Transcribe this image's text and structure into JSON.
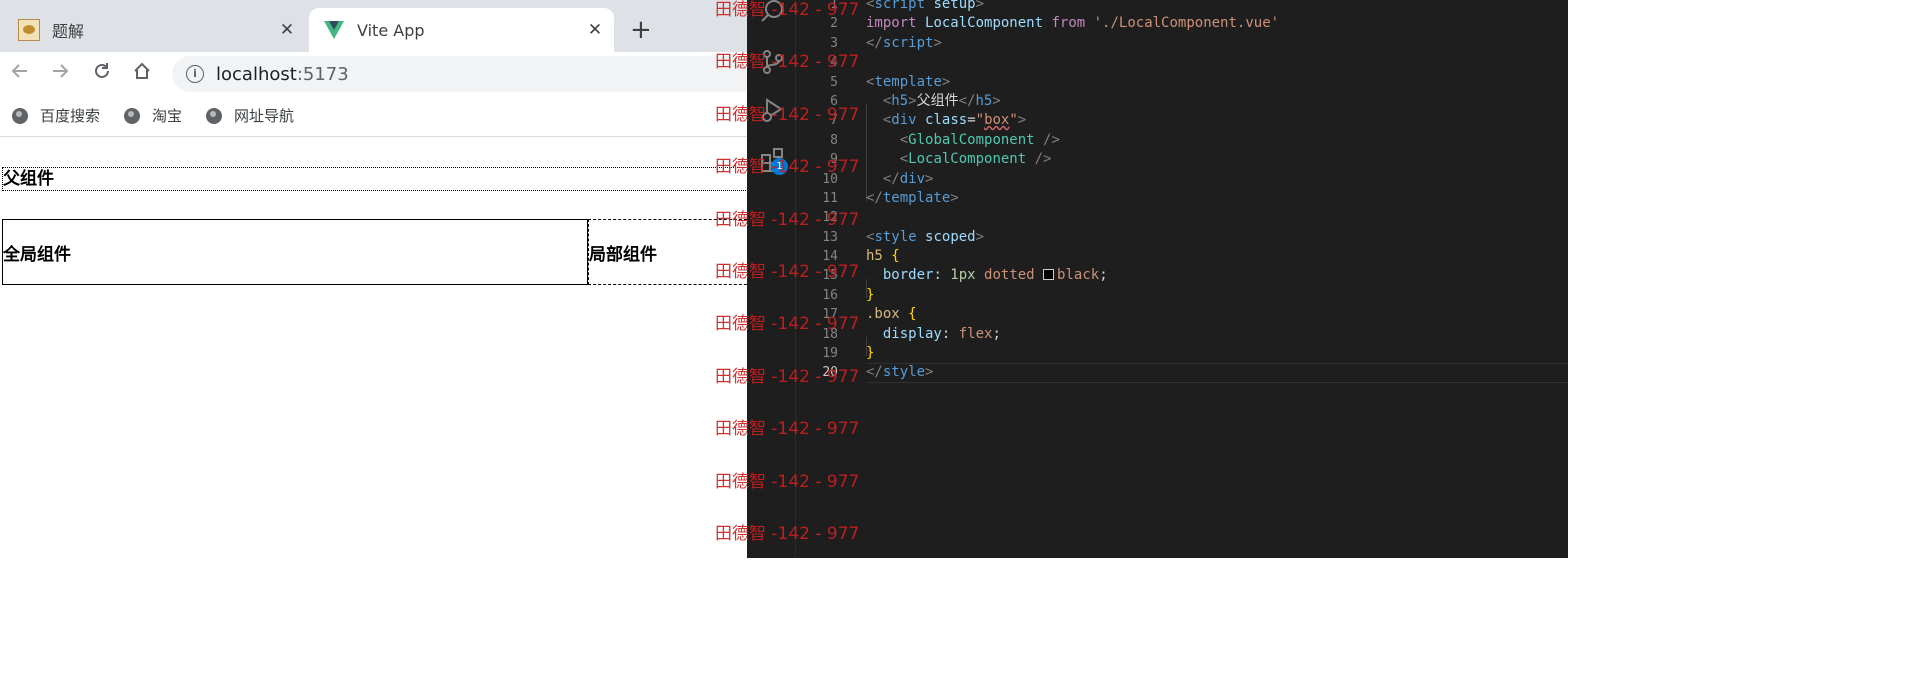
{
  "browser": {
    "tabs": [
      {
        "title": "题解",
        "icon": "cat-favicon-icon"
      },
      {
        "title": "Vite App",
        "icon": "vite-logo-icon",
        "active": true
      }
    ],
    "close_glyph": "✕",
    "new_tab_glyph": "+",
    "url_host": "localhost",
    "url_port": ":5173",
    "bookmarks": [
      "百度搜索",
      "淘宝",
      "网址导航"
    ]
  },
  "page": {
    "heading": "父组件",
    "global_component": "全局组件",
    "local_component": "局部组件"
  },
  "editor": {
    "lines": [
      {
        "n": "1"
      },
      {
        "n": "2"
      },
      {
        "n": "3"
      },
      {
        "n": "4"
      },
      {
        "n": "5"
      },
      {
        "n": "6"
      },
      {
        "n": "7"
      },
      {
        "n": "8"
      },
      {
        "n": "9"
      },
      {
        "n": "10"
      },
      {
        "n": "11"
      },
      {
        "n": "12"
      },
      {
        "n": "13"
      },
      {
        "n": "14"
      },
      {
        "n": "15"
      },
      {
        "n": "16"
      },
      {
        "n": "17"
      },
      {
        "n": "18"
      },
      {
        "n": "19"
      },
      {
        "n": "20"
      }
    ],
    "code": {
      "l1_tag": "script",
      "l1_attr": "setup",
      "l2_kw": "import",
      "l2_name": "LocalComponent",
      "l2_from": "from",
      "l2_str": "'./LocalComponent.vue'",
      "l3_tag": "script",
      "l5_tag": "template",
      "l6_tag": "h5",
      "l6_text": "父组件",
      "l7_tag": "div",
      "l7_attr": "class",
      "l7_val": "box",
      "l8_comp": "GlobalComponent",
      "l9_comp": "LocalComponent",
      "l10_tag": "div",
      "l11_tag": "template",
      "l13_tag": "style",
      "l13_attr": "scoped",
      "l14_sel": "h5",
      "l15_prop": "border",
      "l15_num": "1px",
      "l15_val1": "dotted",
      "l15_val2": "black",
      "l17_sel": ".box",
      "l18_prop": "display",
      "l18_val": "flex",
      "l20_tag": "style"
    },
    "badge": "1",
    "colors": {
      "background": "#1e1e1e",
      "tag": "#569cd6",
      "string": "#ce9178",
      "keyword": "#c586c0",
      "component": "#4ec9b0",
      "selector": "#d7ba7d",
      "badge": "#0078d4"
    }
  },
  "watermark": {
    "text": "田德智 -142 - 977",
    "color": "#cc1f1f",
    "rows": [
      1,
      2,
      3,
      4,
      5,
      6,
      7,
      8,
      9,
      10,
      11
    ]
  }
}
